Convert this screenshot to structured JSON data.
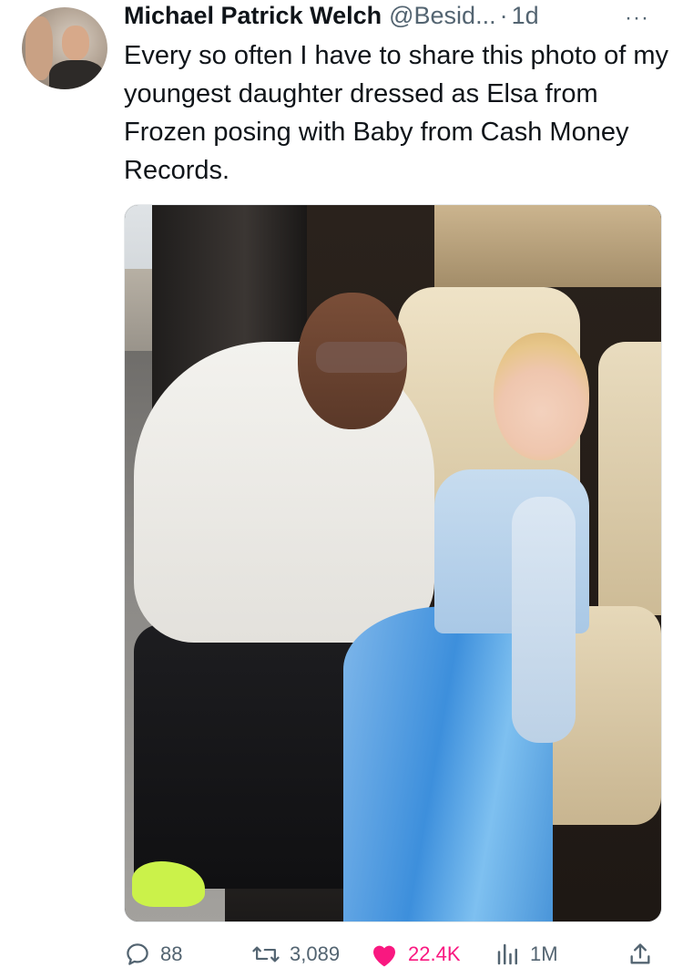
{
  "author": {
    "name": "Michael Patrick Welch",
    "handle": "@Besid...",
    "separator": "·",
    "time": "1d"
  },
  "more_label": "···",
  "tweet": {
    "text": "Every so often I have to share this photo of my youngest daughter dressed as Elsa from Frozen posing with Baby from Cash Money Records."
  },
  "actions": {
    "replies": "88",
    "reposts": "3,089",
    "likes": "22.4K",
    "views": "1M"
  },
  "icons": {
    "reply": "reply-icon",
    "repost": "repost-icon",
    "like": "heart-icon",
    "views": "views-icon",
    "share": "share-icon"
  },
  "colors": {
    "text": "#0f1419",
    "secondary": "#536471",
    "like": "#f91880"
  }
}
